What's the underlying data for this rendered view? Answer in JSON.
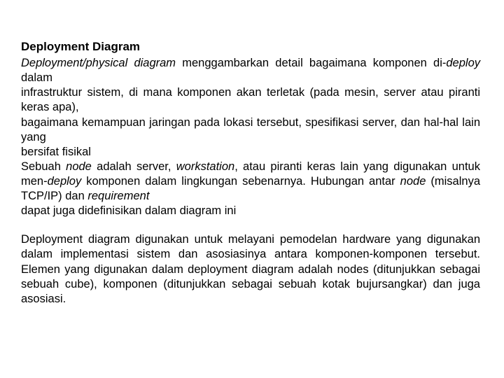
{
  "title": "Deployment Diagram",
  "p1": {
    "a": "Deployment/physical diagram",
    "b": " menggambarkan detail bagaimana komponen di-",
    "c": "deploy",
    "d": " dalam",
    "e": "infrastruktur sistem, di mana komponen akan terletak (pada mesin, server atau piranti keras apa),",
    "f": "bagaimana kemampuan jaringan pada lokasi tersebut, spesifikasi server, dan hal-hal lain yang",
    "g": "bersifat fisikal",
    "h": "Sebuah ",
    "i": "node",
    "j": " adalah server, ",
    "k": "workstation",
    "l": ", atau piranti keras lain yang digunakan untuk men-",
    "m": "deploy",
    "n": "komponen dalam lingkungan sebenarnya. Hubungan antar ",
    "o": "node",
    "p": " (misalnya TCP/IP) dan ",
    "q": "requirement",
    "r": "dapat juga didefinisikan dalam diagram ini"
  },
  "p2": "Deployment diagram digunakan untuk melayani pemodelan hardware yang digunakan dalam implementasi sistem dan asosiasinya antara komponen-komponen tersebut. Elemen yang digunakan dalam deployment diagram adalah nodes (ditunjukkan sebagai sebuah cube), komponen (ditunjukkan sebagai sebuah kotak bujursangkar) dan juga asosiasi."
}
